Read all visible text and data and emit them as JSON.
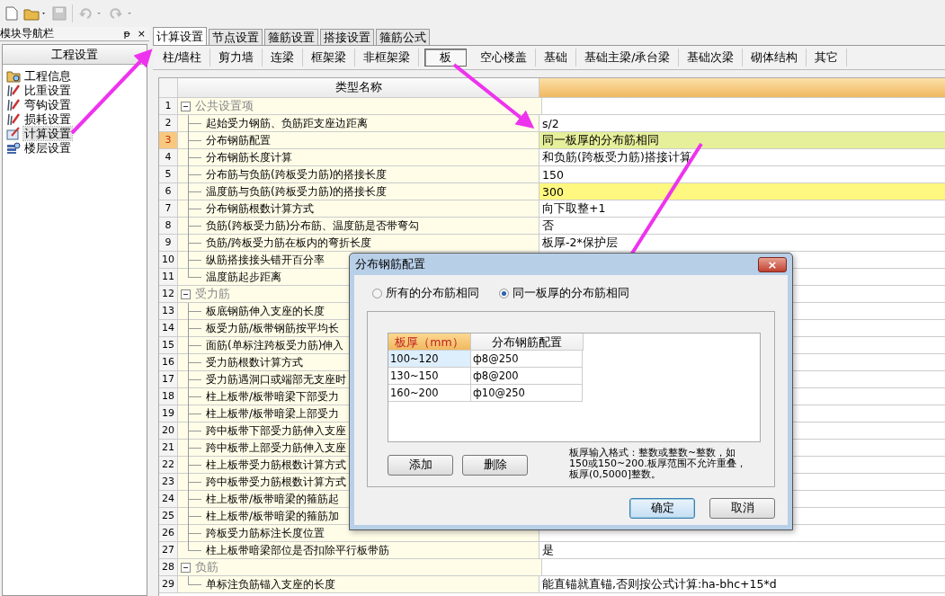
{
  "nav": {
    "title": "模块导航栏",
    "pin": "ᵽ",
    "close": "×",
    "section": "工程设置",
    "items": [
      {
        "label": "工程信息",
        "selected": false
      },
      {
        "label": "比重设置",
        "selected": false
      },
      {
        "label": "弯钩设置",
        "selected": false
      },
      {
        "label": "损耗设置",
        "selected": false
      },
      {
        "label": "计算设置",
        "selected": true
      },
      {
        "label": "楼层设置",
        "selected": false
      }
    ]
  },
  "tabs": [
    {
      "label": "计算设置",
      "selected": true
    },
    {
      "label": "节点设置",
      "selected": false
    },
    {
      "label": "箍筋设置",
      "selected": false
    },
    {
      "label": "搭接设置",
      "selected": false
    },
    {
      "label": "箍筋公式",
      "selected": false
    }
  ],
  "subtabs": [
    {
      "label": "柱/墙柱",
      "selected": false
    },
    {
      "label": "剪力墙",
      "selected": false
    },
    {
      "label": "连梁",
      "selected": false
    },
    {
      "label": "框架梁",
      "selected": false
    },
    {
      "label": "非框架梁",
      "selected": false
    },
    {
      "label": "板",
      "selected": true
    },
    {
      "label": "空心楼盖",
      "selected": false
    },
    {
      "label": "基础",
      "selected": false
    },
    {
      "label": "基础主梁/承台梁",
      "selected": false
    },
    {
      "label": "基础次梁",
      "selected": false
    },
    {
      "label": "砌体结构",
      "selected": false
    },
    {
      "label": "其它",
      "selected": false
    }
  ],
  "grid": {
    "column_header": "类型名称",
    "rows": [
      {
        "number": "1",
        "name": "公共设置项",
        "expanded": true,
        "children": [
          {
            "number": "2",
            "name": "起始受力钢筋、负筋距支座边距离",
            "value": "s/2",
            "selected": false,
            "highlighted": false
          },
          {
            "number": "3",
            "name": "分布钢筋配置",
            "value": "同一板厚的分布筋相同",
            "selected": true,
            "highlighted": false
          },
          {
            "number": "4",
            "name": "分布钢筋长度计算",
            "value": "和负筋(跨板受力筋)搭接计算",
            "selected": false,
            "highlighted": false
          },
          {
            "number": "5",
            "name": "分布筋与负筋(跨板受力筋)的搭接长度",
            "value": "150",
            "selected": false,
            "highlighted": false
          },
          {
            "number": "6",
            "name": "温度筋与负筋(跨板受力筋)的搭接长度",
            "value": "300",
            "selected": false,
            "highlighted": true
          },
          {
            "number": "7",
            "name": "分布钢筋根数计算方式",
            "value": "向下取整+1",
            "selected": false,
            "highlighted": false
          },
          {
            "number": "8",
            "name": "负筋(跨板受力筋)分布筋、温度筋是否带弯勾",
            "value": "否",
            "selected": false,
            "highlighted": false
          },
          {
            "number": "9",
            "name": "负筋/跨板受力筋在板内的弯折长度",
            "value": "板厚-2*保护层",
            "selected": false,
            "highlighted": false
          },
          {
            "number": "10",
            "name": "纵筋搭接接头错开百分率",
            "selected": false,
            "highlighted": false
          },
          {
            "number": "11",
            "name": "温度筋起步距离",
            "selected": false,
            "highlighted": false
          }
        ]
      },
      {
        "number": "12",
        "name": "受力筋",
        "expanded": true,
        "children": [
          {
            "number": "13",
            "name": "板底钢筋伸入支座的长度",
            "selected": false,
            "highlighted": false
          },
          {
            "number": "14",
            "name": "板受力筋/板带钢筋按平均长",
            "selected": false,
            "highlighted": false
          },
          {
            "number": "15",
            "name": "面筋(单标注跨板受力筋)伸入",
            "selected": false,
            "highlighted": false
          },
          {
            "number": "16",
            "name": "受力筋根数计算方式",
            "selected": false,
            "highlighted": false
          },
          {
            "number": "17",
            "name": "受力筋遇洞口或端部无支座时",
            "selected": false,
            "highlighted": false
          },
          {
            "number": "18",
            "name": "柱上板带/板带暗梁下部受力",
            "selected": false,
            "highlighted": false
          },
          {
            "number": "19",
            "name": "柱上板带/板带暗梁上部受力",
            "selected": false,
            "highlighted": false
          },
          {
            "number": "20",
            "name": "跨中板带下部受力筋伸入支座",
            "selected": false,
            "highlighted": false
          },
          {
            "number": "21",
            "name": "跨中板带上部受力筋伸入支座",
            "selected": false,
            "highlighted": false
          },
          {
            "number": "22",
            "name": "柱上板带受力筋根数计算方式",
            "selected": false,
            "highlighted": false
          },
          {
            "number": "23",
            "name": "跨中板带受力筋根数计算方式",
            "selected": false,
            "highlighted": false
          },
          {
            "number": "24",
            "name": "柱上板带/板带暗梁的箍筋起",
            "selected": false,
            "highlighted": false
          },
          {
            "number": "25",
            "name": "柱上板带/板带暗梁的箍筋加",
            "selected": false,
            "highlighted": false
          },
          {
            "number": "26",
            "name": "跨板受力筋标注长度位置",
            "selected": false,
            "highlighted": false
          },
          {
            "number": "27",
            "name": "柱上板带暗梁部位是否扣除平行板带筋",
            "value": "是",
            "selected": false,
            "highlighted": false
          }
        ]
      },
      {
        "number": "28",
        "name": "负筋",
        "expanded": true,
        "children": [
          {
            "number": "29",
            "name": "单标注负筋锚入支座的长度",
            "value": "能直锚就直锚,否则按公式计算:ha-bhc+15*d",
            "selected": false,
            "highlighted": false
          }
        ]
      }
    ]
  },
  "dialog": {
    "title": "分布钢筋配置",
    "close": "×",
    "options": [
      {
        "label": "所有的分布筋相同",
        "selected": false
      },
      {
        "label": "同一板厚的分布筋相同",
        "selected": true
      }
    ],
    "table": {
      "columns": [
        "板厚（mm）",
        "分布钢筋配置"
      ],
      "rows": [
        {
          "cells": [
            "100~120",
            "ф8@250"
          ],
          "selected": true
        },
        {
          "cells": [
            "130~150",
            "ф8@200"
          ],
          "selected": false
        },
        {
          "cells": [
            "160~200",
            "ф10@250"
          ],
          "selected": false
        }
      ]
    },
    "actions": [
      "添加",
      "删除"
    ],
    "note": "板厚输入格式：整数或整数~整数，如150或150~200.板厚范围不允许重叠，板厚(0,5000]整数。",
    "buttons": [
      {
        "label": "确定",
        "default": true
      },
      {
        "label": "取消",
        "default": false
      }
    ]
  }
}
